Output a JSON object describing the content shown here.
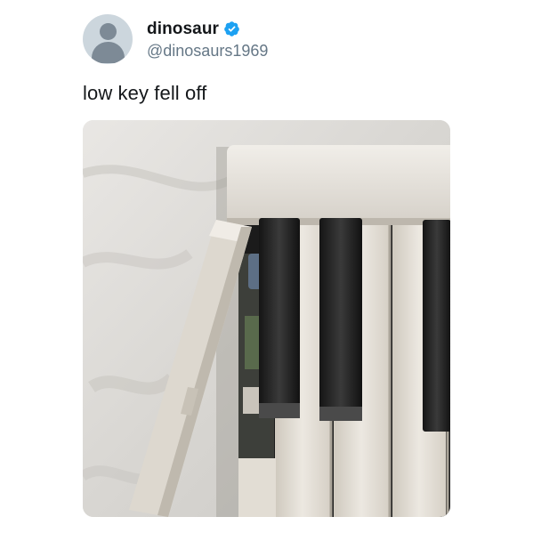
{
  "tweet": {
    "author": {
      "display_name": "dinosaur",
      "handle": "@dinosaurs1969",
      "verified": true,
      "avatar_icon": "default-profile-icon",
      "verified_icon": "verified-badge-icon"
    },
    "text": "low key fell off",
    "media": {
      "alt": "Photo of a piano keyboard on a bed sheet with one white key detached",
      "accent": "#1da1f2"
    }
  }
}
